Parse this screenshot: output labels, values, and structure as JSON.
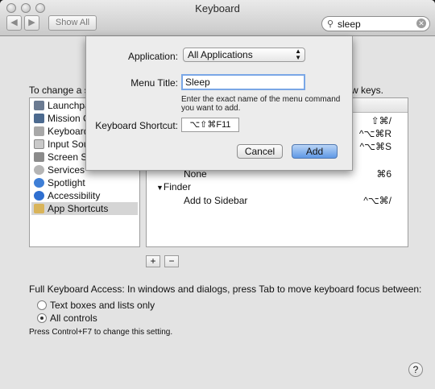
{
  "window": {
    "title": "Keyboard"
  },
  "toolbar": {
    "show_all": "Show All",
    "back_icon": "chevron-left-icon",
    "forward_icon": "chevron-right-icon"
  },
  "search": {
    "value": "sleep"
  },
  "intro": {
    "left": "To change a s",
    "right": "w keys."
  },
  "categories": [
    {
      "label": "Launchpa",
      "icon": "launchpad-icon"
    },
    {
      "label": "Mission C",
      "icon": "mission-control-icon"
    },
    {
      "label": "Keyboard",
      "icon": "keyboard-icon"
    },
    {
      "label": "Input Sou",
      "icon": "input-sources-icon"
    },
    {
      "label": "Screen Sh",
      "icon": "screenshot-icon"
    },
    {
      "label": "Services",
      "icon": "gear-icon"
    },
    {
      "label": "Spotlight",
      "icon": "spotlight-icon"
    },
    {
      "label": "Accessibility",
      "icon": "accessibility-icon"
    },
    {
      "label": "App Shortcuts",
      "icon": "app-shortcuts-icon",
      "selected": true
    }
  ],
  "shortcuts": {
    "visible_keys": [
      "⇧⌘/",
      "^⌥⌘R",
      "^⌥⌘S"
    ],
    "none_label": "None",
    "none_key": "⌘6",
    "finder_group": "Finder",
    "add_to_sidebar": "Add to Sidebar",
    "add_to_sidebar_key": "^⌥⌘/"
  },
  "buttons": {
    "plus": "+",
    "minus": "−"
  },
  "keyboard_access": {
    "label": "Full Keyboard Access: In windows and dialogs, press Tab to move keyboard focus between:",
    "options": [
      {
        "label": "Text boxes and lists only",
        "selected": false
      },
      {
        "label": "All controls",
        "selected": true
      }
    ],
    "note": "Press Control+F7 to change this setting."
  },
  "help": "?",
  "sheet": {
    "application_label": "Application:",
    "application_value": "All Applications",
    "menu_title_label": "Menu Title:",
    "menu_title_value": "Sleep",
    "hint": "Enter the exact name of the menu command you want to add.",
    "shortcut_label": "Keyboard Shortcut:",
    "shortcut_value": "⌥⇧⌘F11",
    "cancel": "Cancel",
    "add": "Add"
  }
}
